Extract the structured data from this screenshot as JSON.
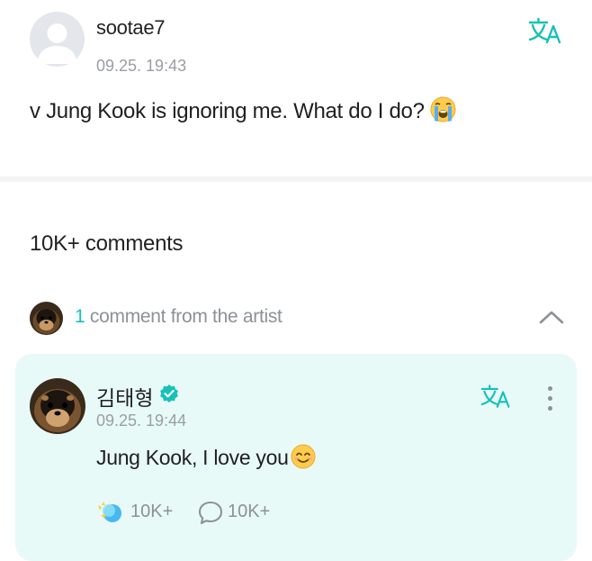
{
  "post": {
    "username": "sootae7",
    "timestamp": "09.25. 19:43",
    "text": "v Jung Kook is ignoring me. What do I do?",
    "emoji": "loudly-crying-face"
  },
  "comments": {
    "count_label": "10K+ comments"
  },
  "artist_section": {
    "count": "1",
    "label": " comment from the artist",
    "expanded": true
  },
  "artist_comment": {
    "name": "김태형",
    "verified": true,
    "timestamp": "09.25. 19:44",
    "text": "Jung Kook, I love you",
    "emoji": "smiling-face",
    "likes": "10K+",
    "replies": "10K+"
  },
  "colors": {
    "accent": "#16c1b8",
    "card_bg": "#e8faf8",
    "muted_text": "#9a9ea4"
  },
  "icons": [
    "translate-icon",
    "chevron-up-icon",
    "verified-icon",
    "more-vertical-icon",
    "like-icon",
    "comment-bubble-icon"
  ]
}
